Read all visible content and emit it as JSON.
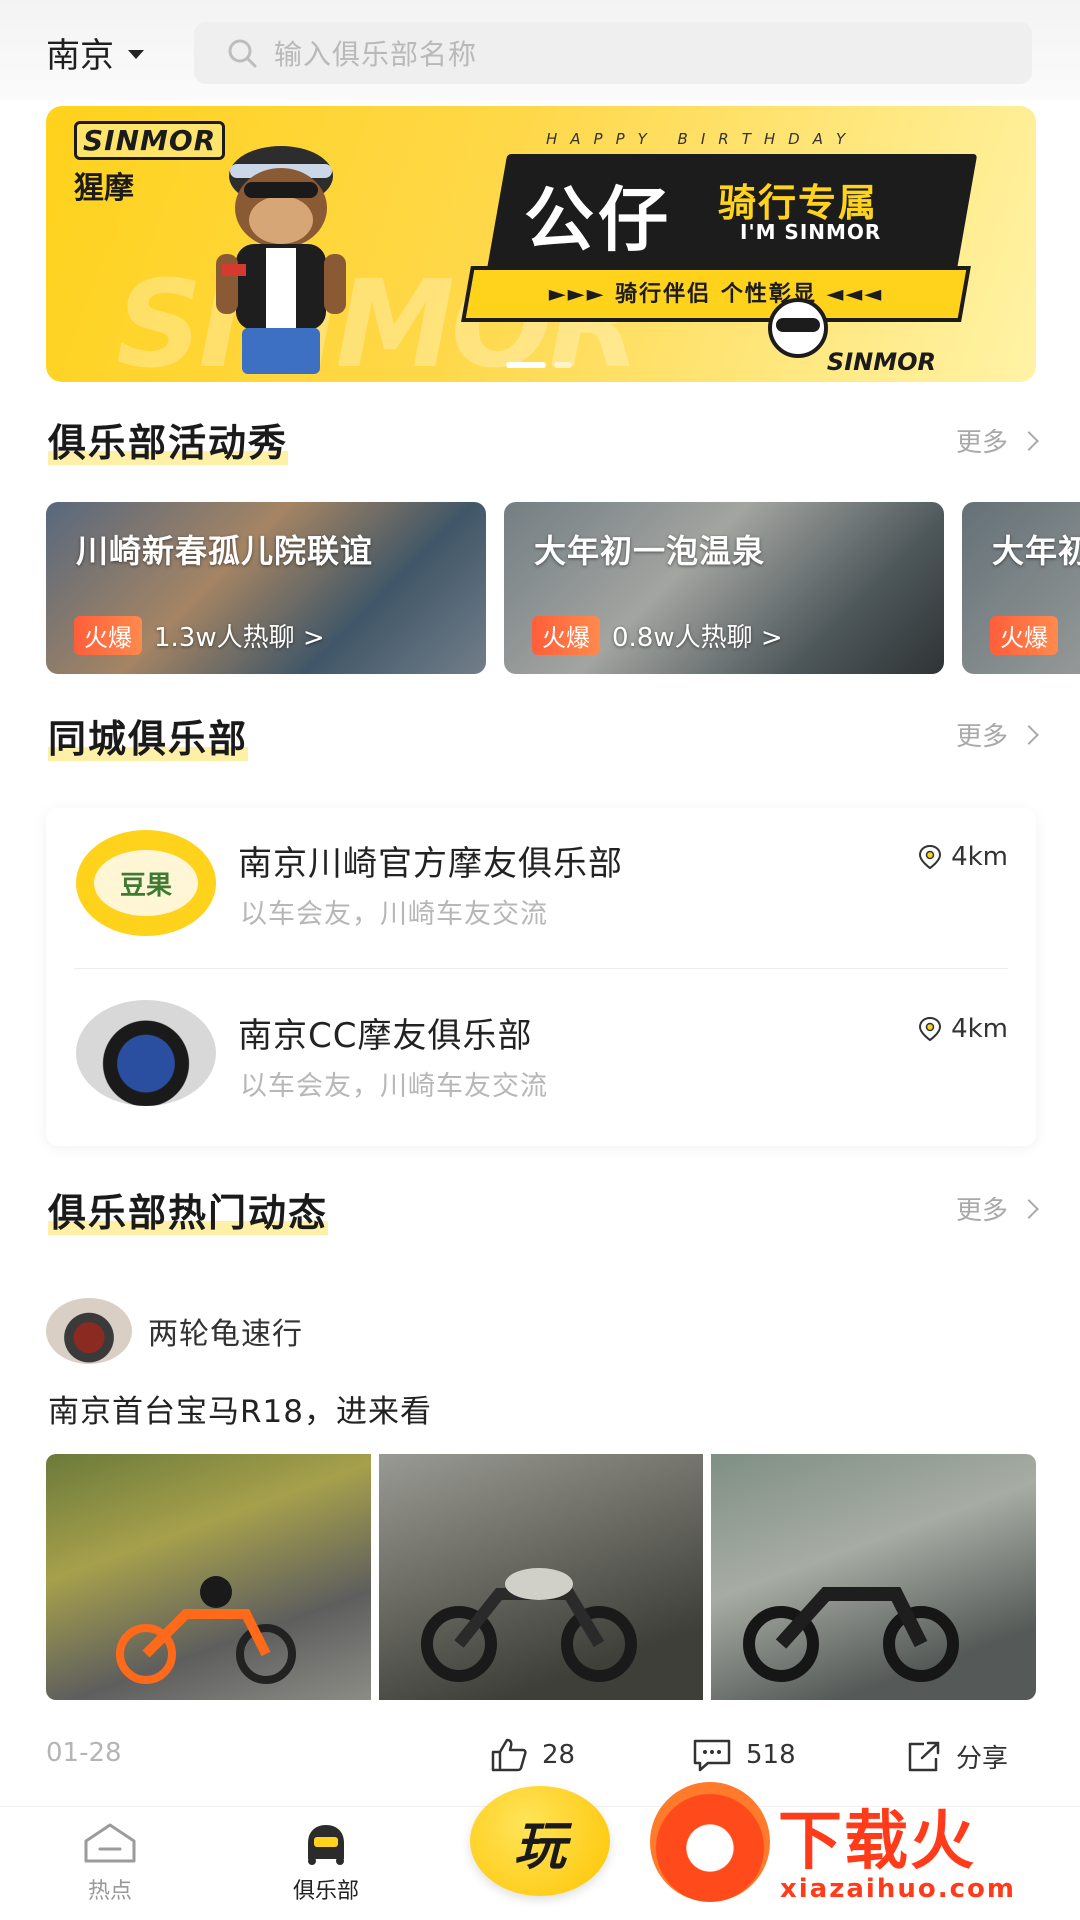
{
  "location": {
    "city": "南京"
  },
  "search": {
    "placeholder": "输入俱乐部名称"
  },
  "banner": {
    "brand_en": "SINMOR",
    "brand_cn": "猩摩",
    "tagline_top": "HAPPY BIRTHDAY",
    "headline": "公仔",
    "headline_sub": "骑行专属",
    "im_line": "I'M SINMOR",
    "slogan": "►►► 骑行伴侣 个性彰显 ◄◄◄",
    "footer_logo": "SINMOR",
    "bg_word": "SINMOR",
    "dot_count": 2,
    "active_dot": 0
  },
  "activities": {
    "title": "俱乐部活动秀",
    "more": "更多",
    "cards": [
      {
        "title": "川崎新春孤儿院联谊",
        "badge": "火爆",
        "count": "1.3w人热聊 >"
      },
      {
        "title": "大年初一泡温泉",
        "badge": "火爆",
        "count": "0.8w人热聊 >"
      },
      {
        "title": "大年初",
        "badge": "火爆",
        "count": ""
      }
    ]
  },
  "clubs": {
    "title": "同城俱乐部",
    "more": "更多",
    "items": [
      {
        "name": "南京川崎官方摩友俱乐部",
        "desc": "以车会友，川崎车友交流",
        "distance": "4km",
        "logo_text": "豆果"
      },
      {
        "name": "南京CC摩友俱乐部",
        "desc": "以车会友，川崎车友交流",
        "distance": "4km"
      }
    ]
  },
  "feed": {
    "title": "俱乐部热门动态",
    "more": "更多",
    "post": {
      "author": "两轮龟速行",
      "title": "南京首台宝马R18，进来看",
      "date": "01-28",
      "likes": "28",
      "comments": "518",
      "share": "分享"
    }
  },
  "tabbar": {
    "tabs": [
      {
        "label": "热点",
        "icon": "home-icon"
      },
      {
        "label": "俱乐部",
        "icon": "club-helmet-icon"
      }
    ],
    "center_label": "玩"
  },
  "watermark": {
    "text": "下载火",
    "url": "xiazaihuo.com"
  },
  "colors": {
    "accent_yellow": "#ffd21c",
    "hot_orange": "#ff5e3a",
    "watermark_red": "#ff3b1a"
  }
}
